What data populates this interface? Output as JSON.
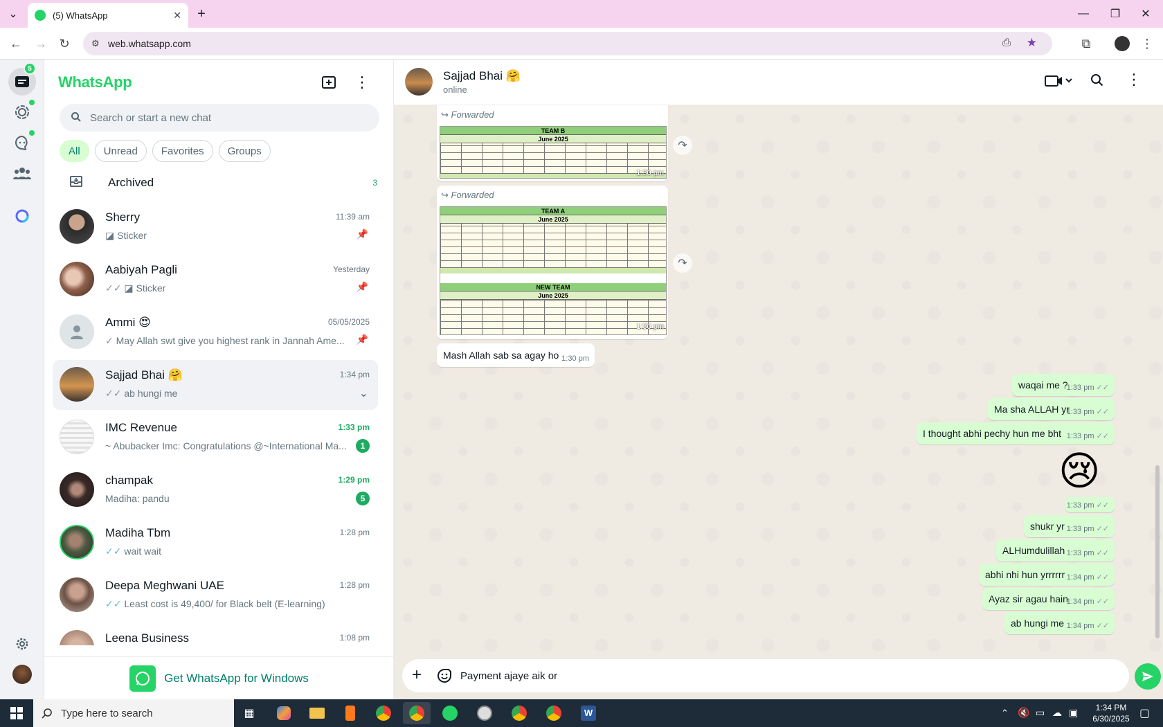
{
  "browser": {
    "tab_title": "(5) WhatsApp",
    "url": "web.whatsapp.com"
  },
  "rail": {
    "chats_badge": "5"
  },
  "sidebar": {
    "brand": "WhatsApp",
    "search_placeholder": "Search or start a new chat",
    "filters": [
      "All",
      "Unread",
      "Favorites",
      "Groups"
    ],
    "archived": {
      "label": "Archived",
      "count": "3"
    },
    "chats": [
      {
        "name": "Sherry",
        "time": "11:39 am",
        "preview": "Sticker"
      },
      {
        "name": "Aabiyah Pagli",
        "time": "Yesterday",
        "preview": "Sticker"
      },
      {
        "name": "Ammi 😍",
        "time": "05/05/2025",
        "preview": "May Allah swt give you highest rank in Jannah  Ame..."
      },
      {
        "name": "Sajjad Bhai 🤗",
        "time": "1:34 pm",
        "preview": "ab hungi me"
      },
      {
        "name": "IMC Revenue",
        "time": "1:33 pm",
        "preview": "~ Abubacker Imc: Congratulations @~International Ma...",
        "badge": "1"
      },
      {
        "name": "champak",
        "time": "1:29 pm",
        "preview": "Madiha: pandu",
        "badge": "5"
      },
      {
        "name": "Madiha Tbm",
        "time": "1:28 pm",
        "preview": "wait wait"
      },
      {
        "name": "Deepa Meghwani UAE",
        "time": "1:28 pm",
        "preview": "Least cost is 49,400/ for Black belt (E-learning)"
      },
      {
        "name": "Leena Business",
        "time": "1:08 pm",
        "preview": ""
      }
    ],
    "get_windows": "Get WhatsApp for Windows"
  },
  "conversation": {
    "name": "Sajjad Bhai 🤗",
    "status": "online",
    "forwarded_label": "Forwarded",
    "images": [
      {
        "title": "TEAM B",
        "subtitle": "June 2025",
        "time": "1:30 pm"
      },
      {
        "title": "TEAM A",
        "subtitle": "June 2025",
        "title2": "NEW TEAM",
        "subtitle2": "June 2025",
        "time": "1:30 pm"
      }
    ],
    "incoming": {
      "text": "Mash Allah sab sa agay ho",
      "time": "1:30 pm"
    },
    "outgoing": [
      {
        "text": "waqai me ?",
        "time": "1:33 pm"
      },
      {
        "text": "Ma sha ALLAH yr",
        "time": "1:33 pm"
      },
      {
        "text": "I thought abhi pechy hun me bht",
        "time": "1:33 pm"
      },
      {
        "text": "",
        "time": "1:33 pm",
        "emoji": "😢"
      },
      {
        "text": "shukr yr",
        "time": "1:33 pm"
      },
      {
        "text": "ALHumdulillah",
        "time": "1:33 pm"
      },
      {
        "text": "abhi nhi hun yrrrrrr",
        "time": "1:34 pm"
      },
      {
        "text": "Ayaz sir agau hain",
        "time": "1:34 pm"
      },
      {
        "text": "ab hungi me",
        "time": "1:34 pm"
      }
    ],
    "composer_text": "Payment ajaye aik or "
  },
  "taskbar": {
    "search_placeholder": "Type here to search",
    "time": "1:34 PM",
    "date": "6/30/2025"
  },
  "colors": {
    "accent": "#25d366",
    "outgoing_bubble": "#d9fdd3",
    "chat_bg": "#efeae2"
  }
}
